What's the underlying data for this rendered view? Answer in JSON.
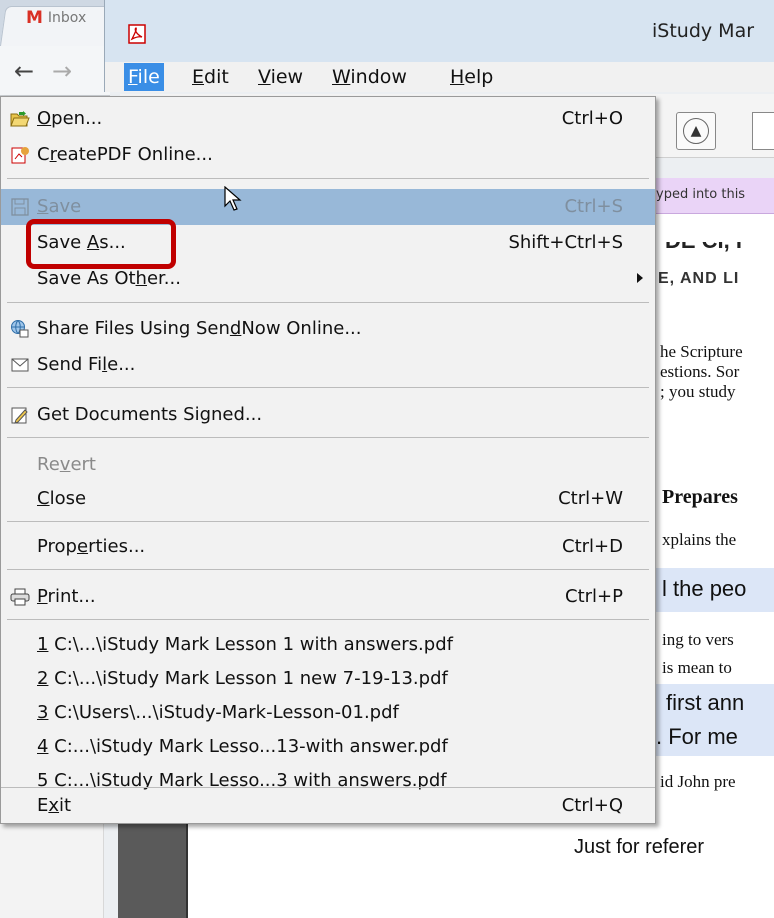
{
  "browser": {
    "tab_label": "Inbox"
  },
  "app": {
    "title": "iStudy Mar"
  },
  "menubar": [
    {
      "label": "File",
      "key": "F",
      "rest": "ile"
    },
    {
      "label": "Edit",
      "key": "E",
      "rest": "dit"
    },
    {
      "label": "View",
      "key": "V",
      "rest": "iew"
    },
    {
      "label": "Window",
      "key": "W",
      "rest": "indow"
    },
    {
      "label": "Help",
      "key": "H",
      "rest": "elp"
    }
  ],
  "document": {
    "banner_text": "yped into this",
    "lines": [
      "E, AND LI",
      "he Scripture",
      "estions. Sor",
      "; you study",
      "Prepares",
      "xplains the",
      "l the peo",
      "ing to vers",
      "is mean to",
      "first ann",
      ". For me",
      "id John pre",
      "Just for referer"
    ]
  },
  "menu": {
    "items": [
      {
        "pre": "",
        "key": "O",
        "post": "pen...",
        "shortcut": "Ctrl+O"
      },
      {
        "pre": "C",
        "key": "r",
        "post": "eatePDF Online...",
        "shortcut": ""
      },
      {
        "pre": "",
        "key": "S",
        "post": "ave",
        "shortcut": "Ctrl+S"
      },
      {
        "pre": "Save ",
        "key": "A",
        "post": "s...",
        "shortcut": "Shift+Ctrl+S"
      },
      {
        "pre": "Save As Ot",
        "key": "h",
        "post": "er...",
        "shortcut": ""
      },
      {
        "pre": "Share Files Using Sen",
        "key": "d",
        "post": "Now Online...",
        "shortcut": ""
      },
      {
        "pre": "Send Fi",
        "key": "l",
        "post": "e...",
        "shortcut": ""
      },
      {
        "pre": "Get Documents Signed...",
        "key": "",
        "post": "",
        "shortcut": ""
      },
      {
        "pre": "Re",
        "key": "v",
        "post": "ert",
        "shortcut": ""
      },
      {
        "pre": "",
        "key": "C",
        "post": "lose",
        "shortcut": "Ctrl+W"
      },
      {
        "pre": "Prop",
        "key": "e",
        "post": "rties...",
        "shortcut": "Ctrl+D"
      },
      {
        "pre": "",
        "key": "P",
        "post": "rint...",
        "shortcut": "Ctrl+P"
      },
      {
        "pre": "",
        "key": "1",
        "post": " C:\\...\\iStudy Mark Lesson 1 with answers.pdf",
        "shortcut": ""
      },
      {
        "pre": "",
        "key": "2",
        "post": " C:\\...\\iStudy Mark Lesson 1 new 7-19-13.pdf",
        "shortcut": ""
      },
      {
        "pre": "",
        "key": "3",
        "post": " C:\\Users\\...\\iStudy-Mark-Lesson-01.pdf",
        "shortcut": ""
      },
      {
        "pre": "",
        "key": "4",
        "post": " C:...\\iStudy Mark Lesso...13-with answer.pdf",
        "shortcut": ""
      },
      {
        "pre": "",
        "key": "5",
        "post": " C:...\\iStudy Mark Lesso...3 with answers.pdf",
        "shortcut": ""
      },
      {
        "pre": "E",
        "key": "x",
        "post": "it",
        "shortcut": "Ctrl+Q"
      }
    ]
  },
  "colors": {
    "highlight": "#98b8d8",
    "annotation_box": "#c00000",
    "menubar_active": "#3a8ee6"
  }
}
